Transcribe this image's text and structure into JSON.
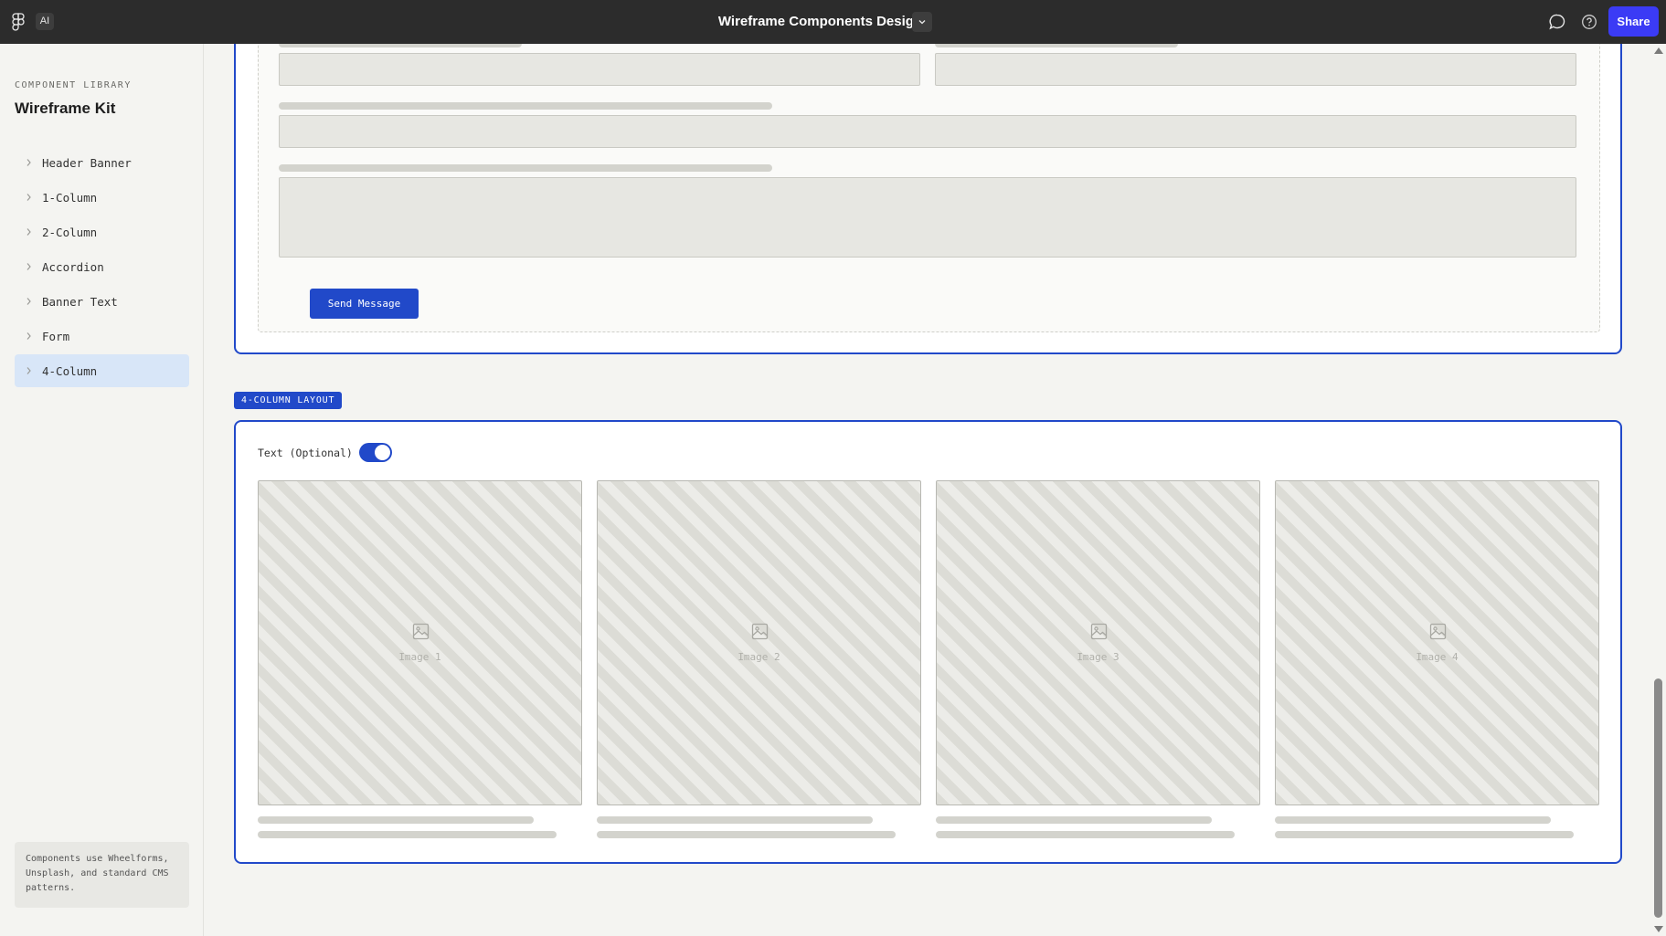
{
  "app": {
    "ai_label": "AI",
    "document_title": "Wireframe Components Design",
    "share_label": "Share"
  },
  "sidebar": {
    "library_label": "COMPONENT LIBRARY",
    "kit_title": "Wireframe Kit",
    "items": [
      {
        "label": "Header Banner",
        "active": false
      },
      {
        "label": "1-Column",
        "active": false
      },
      {
        "label": "2-Column",
        "active": false
      },
      {
        "label": "Accordion",
        "active": false
      },
      {
        "label": "Banner Text",
        "active": false
      },
      {
        "label": "Form",
        "active": false
      },
      {
        "label": "4-Column",
        "active": true
      }
    ],
    "note": "Components use Wheelforms, Unsplash, and standard CMS patterns."
  },
  "form_section": {
    "submit_label": "Send Message"
  },
  "four_column": {
    "tag": "4-COLUMN LAYOUT",
    "toggle_label": "Text (Optional)",
    "toggle_on": true,
    "images": [
      "Image 1",
      "Image 2",
      "Image 3",
      "Image 4"
    ]
  },
  "colors": {
    "topbar": "#2c2c2c",
    "share": "#3b3bf5",
    "accent": "#2149c9",
    "active_item": "#d8e6f8"
  },
  "icons": {
    "logo": "figma-logo-icon",
    "title_menu": "chevron-down-icon",
    "comment": "comment-bubble-icon",
    "help": "help-circle-icon",
    "nav_chevron": "chevron-right-icon",
    "image_placeholder": "image-icon"
  }
}
